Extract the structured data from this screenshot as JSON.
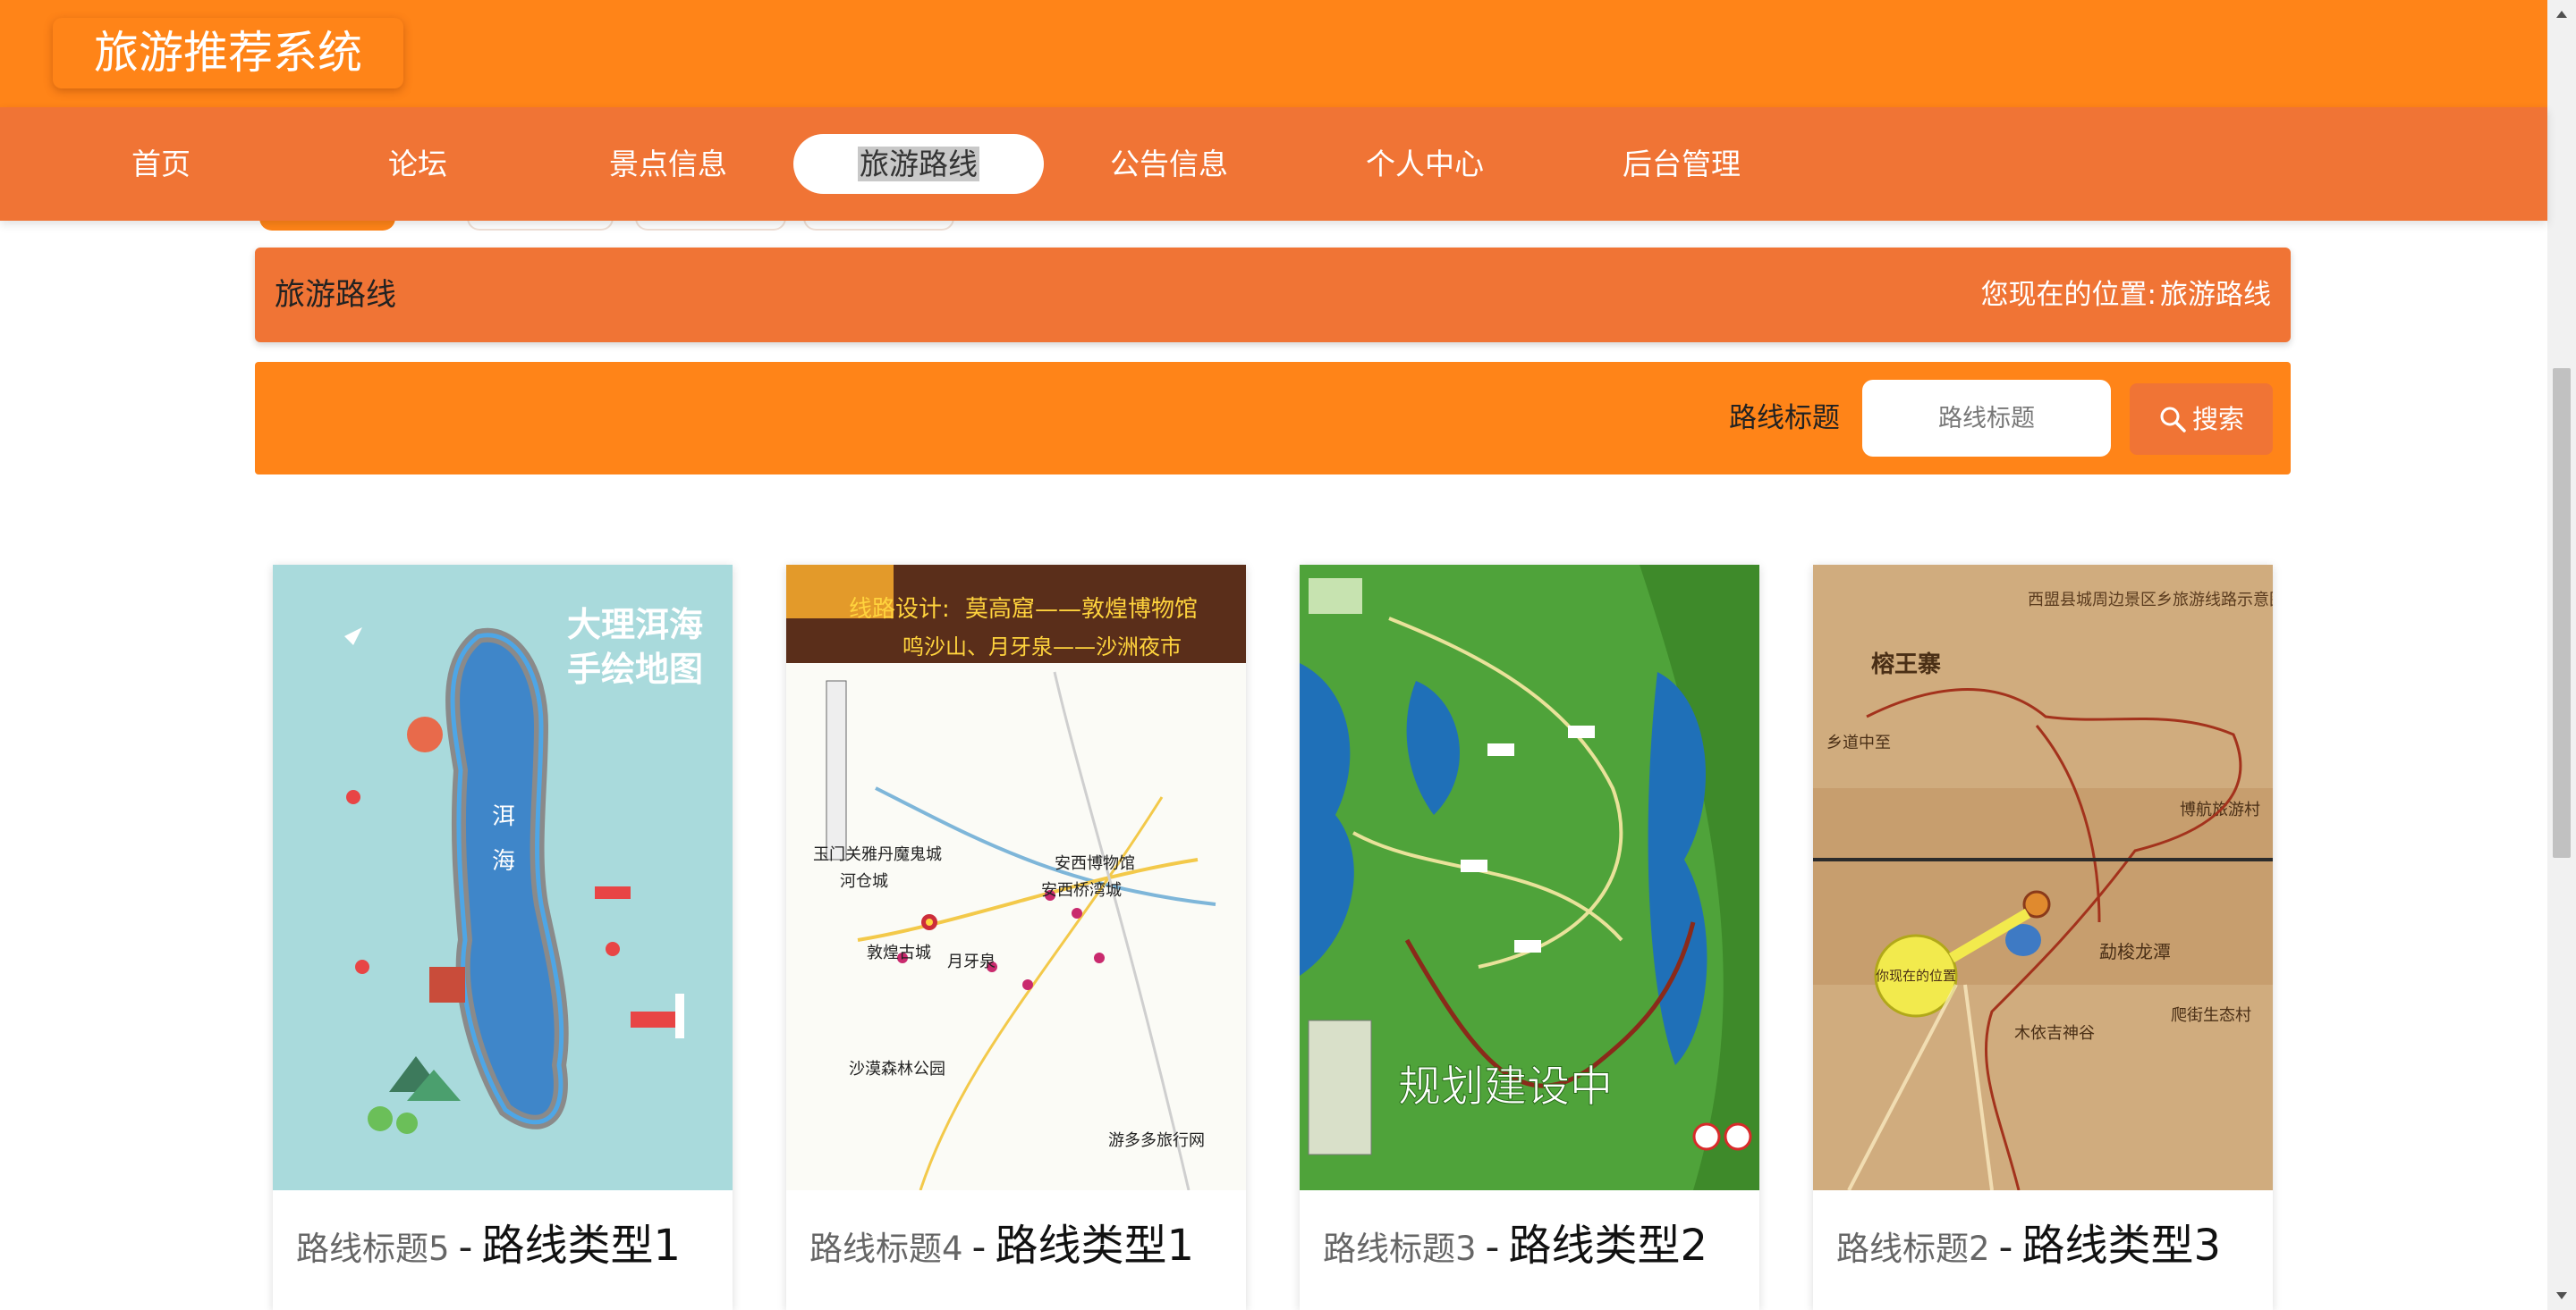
{
  "header": {
    "logo": "旅游推荐系统"
  },
  "nav": {
    "items": [
      {
        "label": "首页",
        "active": false
      },
      {
        "label": "论坛",
        "active": false
      },
      {
        "label": "景点信息",
        "active": false
      },
      {
        "label": "旅游路线",
        "active": true
      },
      {
        "label": "公告信息",
        "active": false
      },
      {
        "label": "个人中心",
        "active": false
      },
      {
        "label": "后台管理",
        "active": false
      }
    ]
  },
  "breadcrumb": {
    "title": "旅游路线",
    "location_label": "您现在的位置:",
    "location_value": "旅游路线"
  },
  "search": {
    "label": "路线标题",
    "placeholder": "路线标题",
    "button_label": "搜索"
  },
  "cards": [
    {
      "title": "路线标题5",
      "separator": "-",
      "type": "路线类型1",
      "map_title": "大理洱海手绘地图"
    },
    {
      "title": "路线标题4",
      "separator": "-",
      "type": "路线类型1",
      "map_title": "线路设计:莫高窟——敦煌博物馆"
    },
    {
      "title": "路线标题3",
      "separator": "-",
      "type": "路线类型2",
      "map_title": "规划建设中"
    },
    {
      "title": "路线标题2",
      "separator": "-",
      "type": "路线类型3",
      "map_title": "榕王寨"
    }
  ],
  "colors": {
    "header": "#ff8418",
    "nav": "#f07435",
    "accent": "#ff8418",
    "button": "#f07435"
  }
}
